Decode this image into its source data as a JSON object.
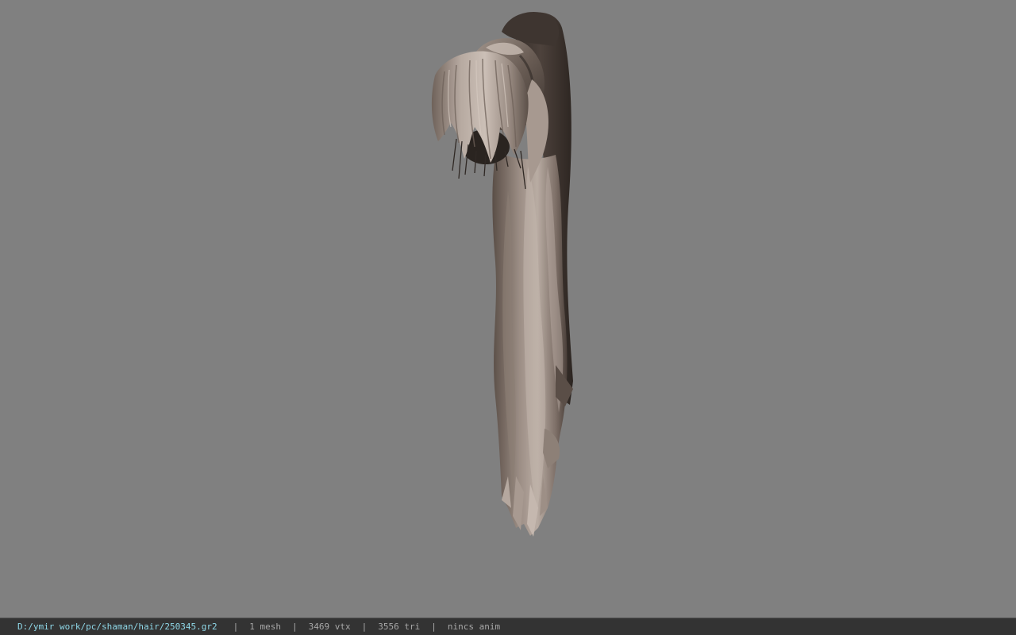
{
  "viewer": {
    "background_color": "#808080",
    "model": {
      "name": "ponytail-hair-model",
      "colors": {
        "dark": "#3b332e",
        "mid": "#6f625a",
        "light": "#b2a59c",
        "highlight": "#cbbfb6"
      }
    }
  },
  "status_bar": {
    "file_path": "D:/ymir work/pc/shaman/hair/250345.gr2",
    "separator": "|",
    "mesh_count": "1 mesh",
    "vertex_count": "3469 vtx",
    "triangle_count": "3556 tri",
    "anim_status": "nincs anim",
    "colors": {
      "background": "#333333",
      "path_text": "#8fd8e8",
      "info_text": "#a8a8a8"
    }
  }
}
